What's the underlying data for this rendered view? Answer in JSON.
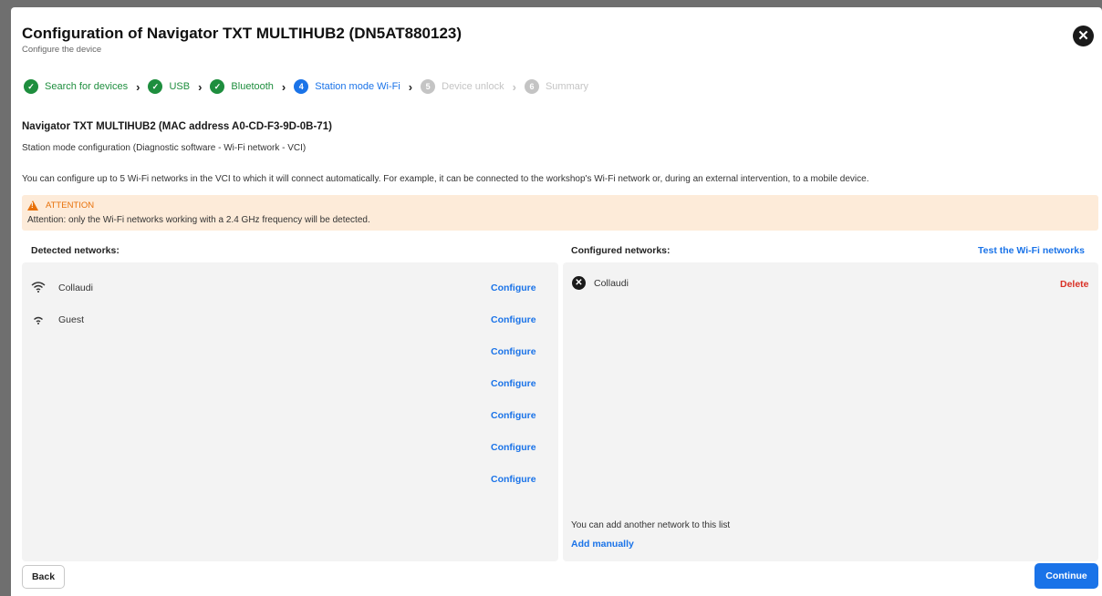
{
  "header": {
    "title": "Configuration of Navigator TXT MULTIHUB2 (DN5AT880123)",
    "subtitle": "Configure the device"
  },
  "stepper": {
    "steps": [
      {
        "label": "Search for devices",
        "status": "done",
        "marker": "✓"
      },
      {
        "label": "USB",
        "status": "done",
        "marker": "✓"
      },
      {
        "label": "Bluetooth",
        "status": "done",
        "marker": "✓"
      },
      {
        "label": "Station mode Wi-Fi",
        "status": "active",
        "marker": "4"
      },
      {
        "label": "Device unlock",
        "status": "pending",
        "marker": "5"
      },
      {
        "label": "Summary",
        "status": "pending",
        "marker": "6"
      }
    ]
  },
  "device": {
    "title": "Navigator TXT MULTIHUB2 (MAC address A0-CD-F3-9D-0B-71)",
    "config_subtitle": "Station mode configuration (Diagnostic software - Wi-Fi network - VCI)",
    "info": "You can configure up to 5 Wi-Fi networks in the VCI to which it will connect automatically. For example, it can be connected to the workshop's Wi-Fi network or, during an external intervention, to a mobile device."
  },
  "attention": {
    "heading": "ATTENTION",
    "text": "Attention: only the Wi-Fi networks working with a 2.4 GHz frequency will be detected."
  },
  "detected": {
    "label": "Detected networks:",
    "rows": [
      {
        "name": "Collaudi",
        "signal": "full",
        "action": "Configure"
      },
      {
        "name": "Guest",
        "signal": "medium",
        "action": "Configure"
      },
      {
        "name": "",
        "signal": "",
        "action": "Configure"
      },
      {
        "name": "",
        "signal": "",
        "action": "Configure"
      },
      {
        "name": "",
        "signal": "",
        "action": "Configure"
      },
      {
        "name": "",
        "signal": "",
        "action": "Configure"
      },
      {
        "name": "",
        "signal": "",
        "action": "Configure"
      }
    ]
  },
  "configured": {
    "label": "Configured networks:",
    "test_link": "Test the Wi-Fi networks",
    "rows": [
      {
        "name": "Collaudi",
        "action": "Delete"
      }
    ],
    "add_text": "You can add another network to this list",
    "add_link": "Add manually"
  },
  "footer": {
    "back": "Back",
    "continue": "Continue"
  },
  "colors": {
    "primary": "#1a73e8",
    "success": "#1e8e3e",
    "danger": "#d93025",
    "warning": "#e8710a",
    "warning_bg": "#fdebd9",
    "panel_bg": "#f3f3f3"
  }
}
